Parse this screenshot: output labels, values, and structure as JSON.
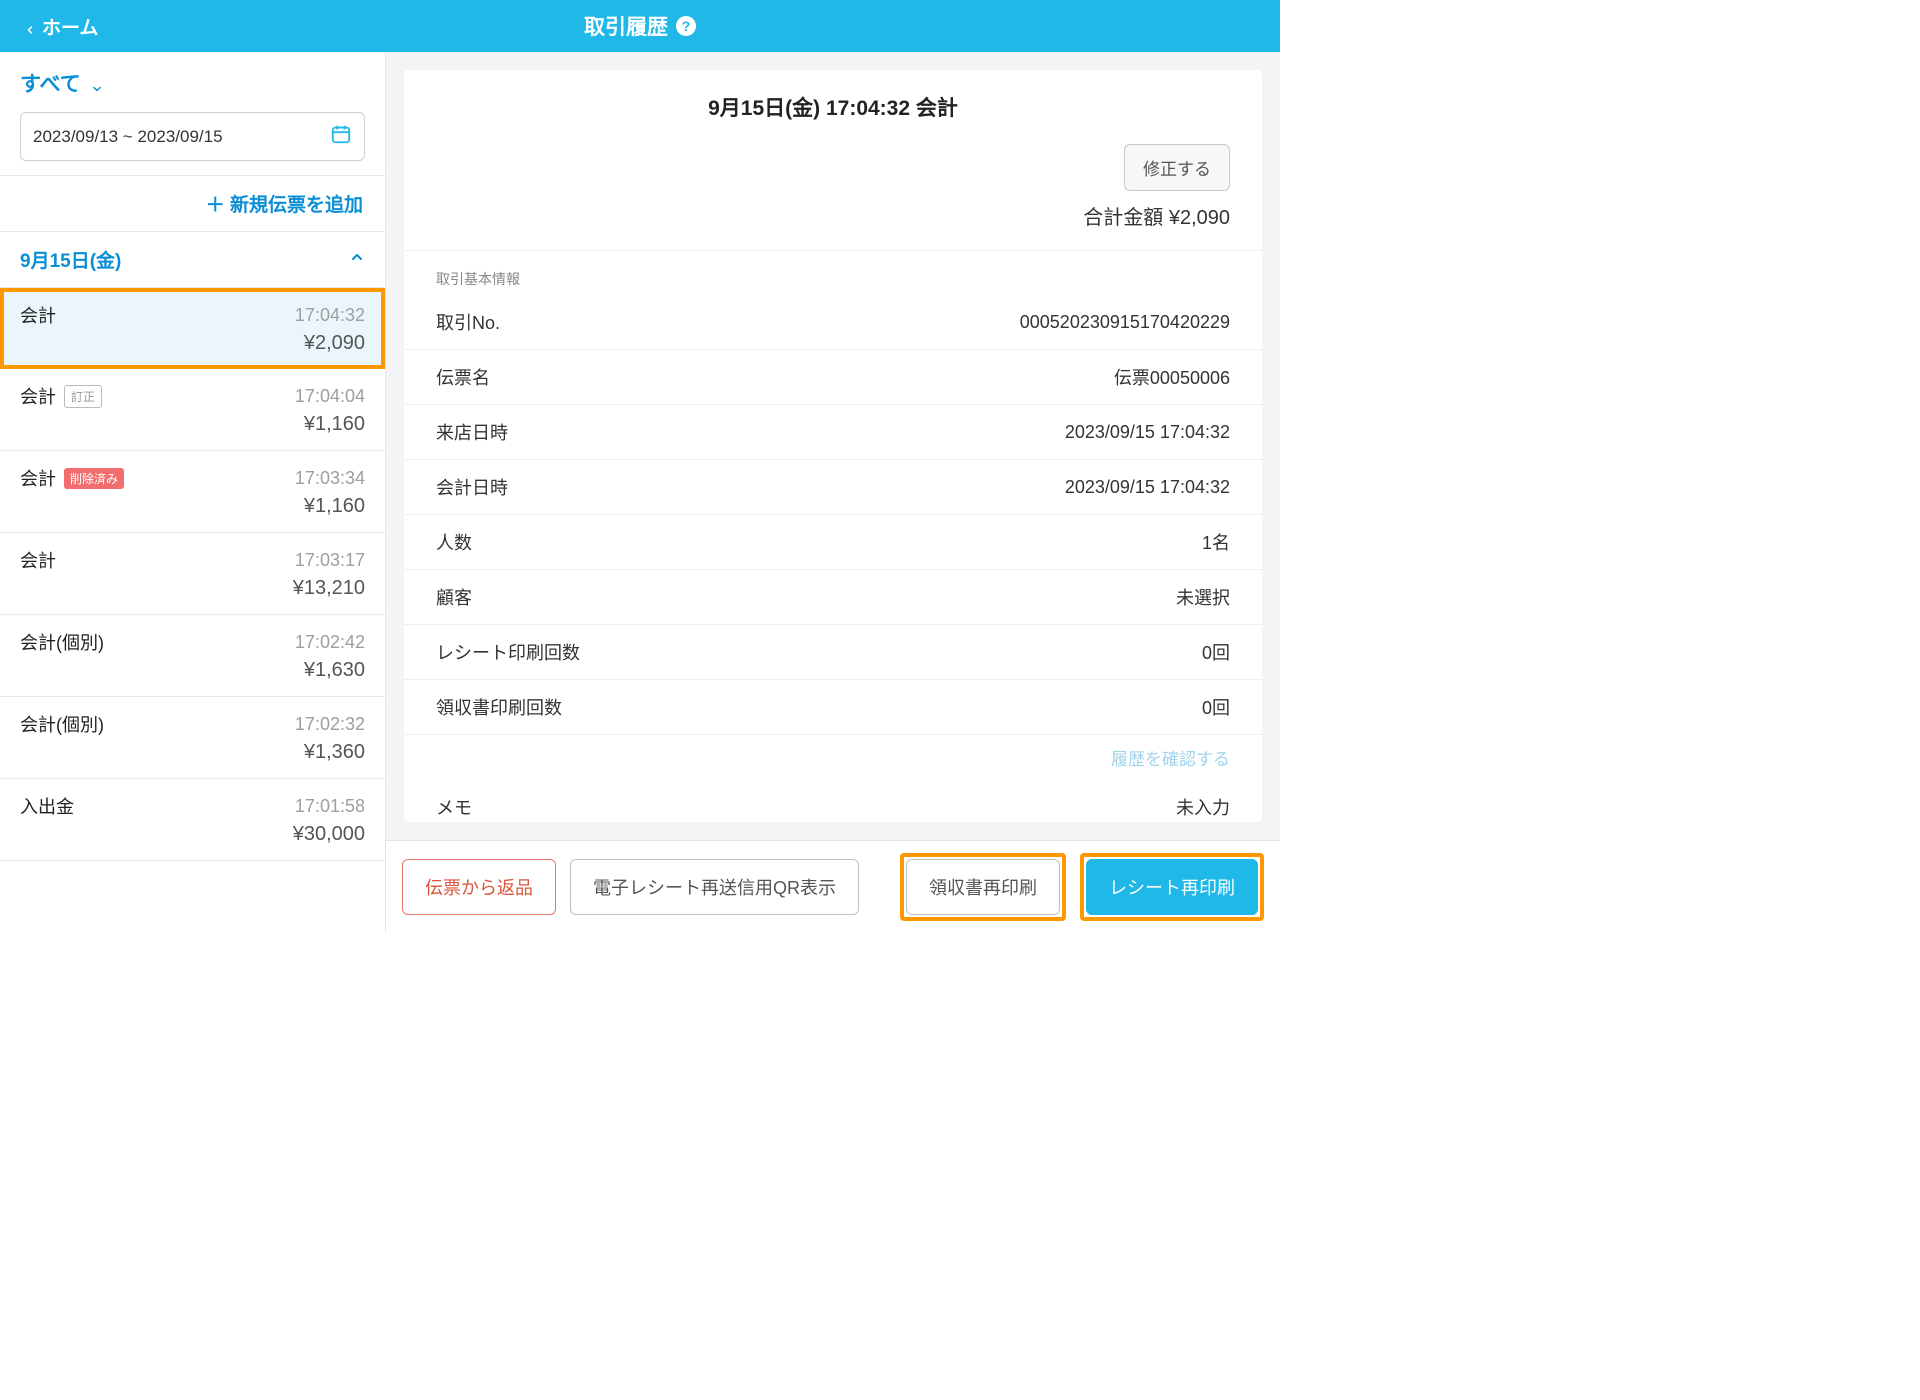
{
  "header": {
    "home_label": "ホーム",
    "title": "取引履歴"
  },
  "filter": {
    "scope_label": "すべて",
    "date_range": "2023/09/13 ~ 2023/09/15",
    "add_slip_label": "＋ 新規伝票を追加"
  },
  "date_section_label": "9月15日(金)",
  "transactions": [
    {
      "type": "会計",
      "badge": null,
      "time": "17:04:32",
      "amount": "¥2,090",
      "selected": true
    },
    {
      "type": "会計",
      "badge": "訂正",
      "badge_kind": "corr",
      "time": "17:04:04",
      "amount": "¥1,160",
      "selected": false
    },
    {
      "type": "会計",
      "badge": "削除済み",
      "badge_kind": "del",
      "time": "17:03:34",
      "amount": "¥1,160",
      "selected": false
    },
    {
      "type": "会計",
      "badge": null,
      "time": "17:03:17",
      "amount": "¥13,210",
      "selected": false
    },
    {
      "type": "会計(個別)",
      "badge": null,
      "time": "17:02:42",
      "amount": "¥1,630",
      "selected": false
    },
    {
      "type": "会計(個別)",
      "badge": null,
      "time": "17:02:32",
      "amount": "¥1,360",
      "selected": false
    },
    {
      "type": "入出金",
      "badge": null,
      "time": "17:01:58",
      "amount": "¥30,000",
      "selected": false
    }
  ],
  "detail": {
    "title": "9月15日(金) 17:04:32 会計",
    "edit_label": "修正する",
    "total_label": "合計金額 ¥2,090",
    "section_title": "取引基本情報",
    "rows": [
      {
        "label": "取引No.",
        "value": "00052023​0915​1704​20229"
      },
      {
        "label": "伝票名",
        "value": "伝票00050006"
      },
      {
        "label": "来店日時",
        "value": "2023/09/15 17:04:32"
      },
      {
        "label": "会計日時",
        "value": "2023/09/15 17:04:32"
      },
      {
        "label": "人数",
        "value": "1名"
      },
      {
        "label": "顧客",
        "value": "未選択"
      },
      {
        "label": "レシート印刷回数",
        "value": "0回"
      },
      {
        "label": "領収書印刷回数",
        "value": "0回"
      }
    ],
    "history_link": "履歴を確認する",
    "memo_label": "メモ",
    "memo_value": "未入力"
  },
  "footer": {
    "return_label": "伝票から返品",
    "qr_label": "電子レシート再送信用QR表示",
    "reprint_receipt_label": "領収書再印刷",
    "reprint_slip_label": "レシート再印刷"
  }
}
